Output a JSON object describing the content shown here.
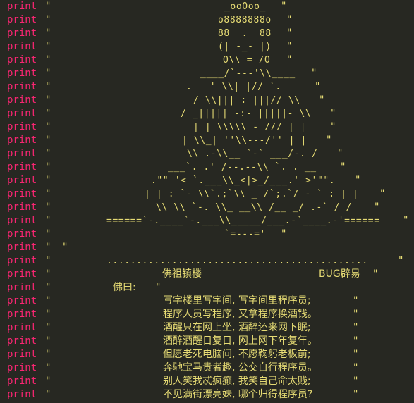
{
  "keyword": "print",
  "open_quote": "\"",
  "art_lines": [
    "_ooOoo_",
    "o8888888o",
    "88  .  88",
    "(| -_- |)",
    "O\\\\ = /O",
    "____/`---'\\\\____",
    ".   ' \\\\| |// `.",
    "/ \\\\||| : |||// \\\\",
    "/ _||||| -:- |||||- \\\\",
    "| | \\\\\\\\\\ - /// | |",
    "| \\\\_| ''\\\\---/'' | |",
    "\\\\ .-\\\\__ `-` ___/-. /",
    "___`. .' /--.--\\\\ `. . __",
    ".\"\" '< `.___\\\\_<|>_/___.' >'\"\".",
    "| | : `- \\\\`.;`\\\\ _ /`;.`/ - ` : | |",
    "\\\\ \\\\ `-. \\\\_ __\\\\ /__ _/ .-` / /",
    "======`-.____`-.___\\\\_____/___.-`____.-'======",
    "`=---='",
    "",
    "............................................",
    ""
  ],
  "header_left": "佛祖镇楼",
  "header_right": "BUG辟易",
  "foyue": "佛曰:",
  "poem_lines": [
    "写字楼里写字间, 写字间里程序员;",
    "程序人员写程序, 又拿程序换酒钱。",
    "酒醒只在网上坐, 酒醉还来网下眠;",
    "酒醉酒醒日复日, 网上网下年复年。",
    "但愿老死电脑间, 不愿鞠躬老板前;",
    "奔驰宝马贵者趣, 公交自行程序员。",
    "别人笑我忒疯癫, 我笑自己命太贱;",
    "不见满街漂亮妹, 哪个归得程序员?"
  ],
  "colors": {
    "background": "#272822",
    "keyword": "#f92672",
    "string": "#e6db74"
  }
}
